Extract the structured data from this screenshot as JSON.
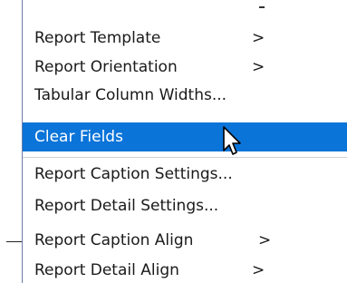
{
  "menu": {
    "items": [
      {
        "label": "Report Template",
        "arrow": ">"
      },
      {
        "label": "Report Orientation",
        "arrow": ">"
      },
      {
        "label": "Tabular Column Widths..."
      },
      {
        "label": "Clear Fields",
        "highlighted": true
      },
      {
        "label": "Report Caption Settings..."
      },
      {
        "label": "Report Detail Settings..."
      },
      {
        "label": "Report Caption Align",
        "arrow": ">"
      },
      {
        "label": "Report Detail Align",
        "arrow": ">"
      }
    ]
  },
  "colors": {
    "highlight": "#0a74d9",
    "text": "#1a1a1a"
  },
  "icons": {
    "cursor": "mouse-pointer-icon"
  }
}
